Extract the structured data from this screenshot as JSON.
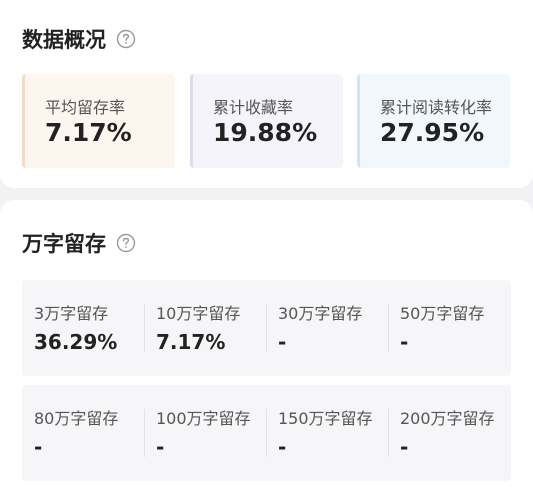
{
  "overview": {
    "title": "数据概况",
    "metrics": [
      {
        "label": "平均留存率",
        "value": "7.17%"
      },
      {
        "label": "累计收藏率",
        "value": "19.88%"
      },
      {
        "label": "累计阅读转化率",
        "value": "27.95%"
      }
    ]
  },
  "retention": {
    "title": "万字留存",
    "row1": [
      {
        "label": "3万字留存",
        "value": "36.29%"
      },
      {
        "label": "10万字留存",
        "value": "7.17%"
      },
      {
        "label": "30万字留存",
        "value": "-"
      },
      {
        "label": "50万字留存",
        "value": "-"
      }
    ],
    "row2": [
      {
        "label": "80万字留存",
        "value": "-"
      },
      {
        "label": "100万字留存",
        "value": "-"
      },
      {
        "label": "150万字留存",
        "value": "-"
      },
      {
        "label": "200万字留存",
        "value": "-"
      }
    ]
  },
  "icons": {
    "help": "question-circle-icon"
  },
  "colors": {
    "card1_bg": "#fdf6ef",
    "card2_bg": "#f5f4fb",
    "card3_bg": "#f2f7fc"
  }
}
